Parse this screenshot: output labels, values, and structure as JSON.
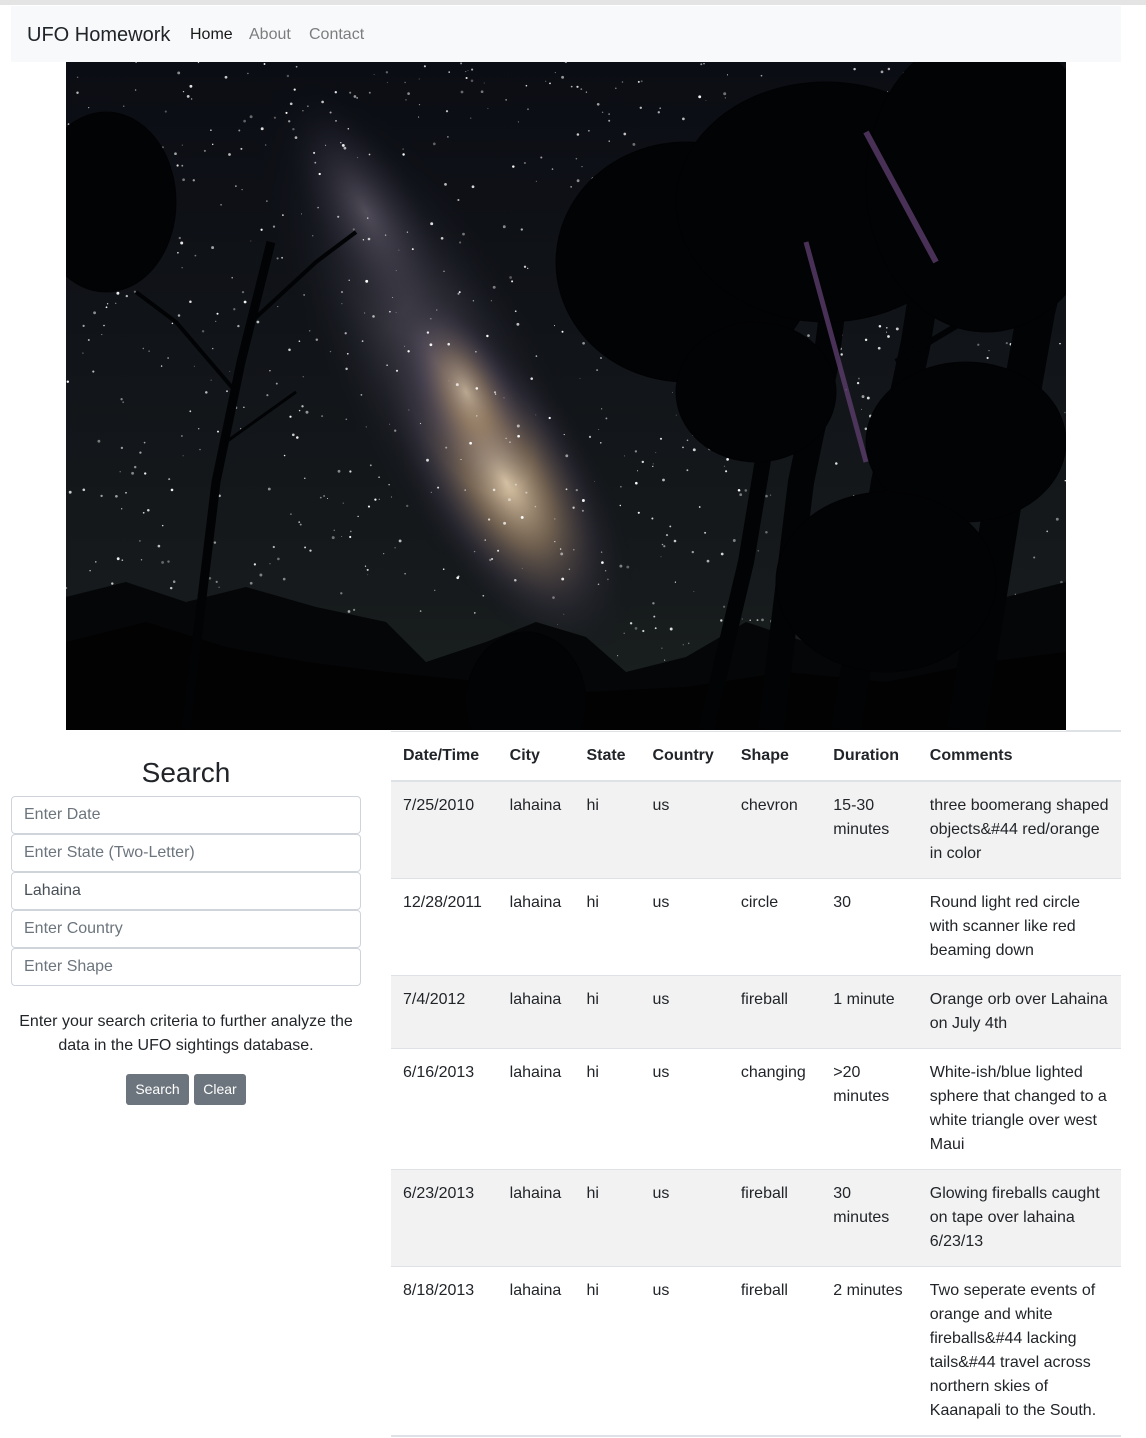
{
  "navbar": {
    "brand": "UFO Homework",
    "links": [
      {
        "label": "Home",
        "active": true
      },
      {
        "label": "About",
        "active": false
      },
      {
        "label": "Contact",
        "active": false
      }
    ]
  },
  "hero": {
    "icon": "night-sky-milky-way-image"
  },
  "search": {
    "title": "Search",
    "fields": [
      {
        "placeholder": "Enter Date",
        "value": ""
      },
      {
        "placeholder": "Enter State (Two-Letter)",
        "value": ""
      },
      {
        "placeholder": "Enter City",
        "value": "Lahaina"
      },
      {
        "placeholder": "Enter Country",
        "value": ""
      },
      {
        "placeholder": "Enter Shape",
        "value": ""
      }
    ],
    "help_text": "Enter your search criteria to further analyze the data in the UFO sightings database.",
    "search_label": "Search",
    "clear_label": "Clear"
  },
  "table": {
    "headers": [
      "Date/Time",
      "City",
      "State",
      "Country",
      "Shape",
      "Duration",
      "Comments"
    ],
    "rows": [
      [
        "7/25/2010",
        "lahaina",
        "hi",
        "us",
        "chevron",
        "15-30 minutes",
        "three boomerang shaped objects&#44 red/orange in color"
      ],
      [
        "12/28/2011",
        "lahaina",
        "hi",
        "us",
        "circle",
        "30",
        "Round light red circle with scanner like red beaming down"
      ],
      [
        "7/4/2012",
        "lahaina",
        "hi",
        "us",
        "fireball",
        "1 minute",
        "Orange orb over Lahaina on July 4th"
      ],
      [
        "6/16/2013",
        "lahaina",
        "hi",
        "us",
        "changing",
        ">20 minutes",
        "White-ish/blue lighted sphere that changed to a white triangle over west Maui"
      ],
      [
        "6/23/2013",
        "lahaina",
        "hi",
        "us",
        "fireball",
        "30 minutes",
        "Glowing fireballs caught on tape over lahaina 6/23/13"
      ],
      [
        "8/18/2013",
        "lahaina",
        "hi",
        "us",
        "fireball",
        "2 minutes",
        "Two seperate events of orange and white fireballs&#44 lacking tails&#44 travel across northern skies of Kaanapali to the South."
      ]
    ]
  },
  "colors": {
    "navbar_bg": "#f8f9fa",
    "button_bg": "#6c757d",
    "stripe_bg": "#f2f2f2"
  }
}
